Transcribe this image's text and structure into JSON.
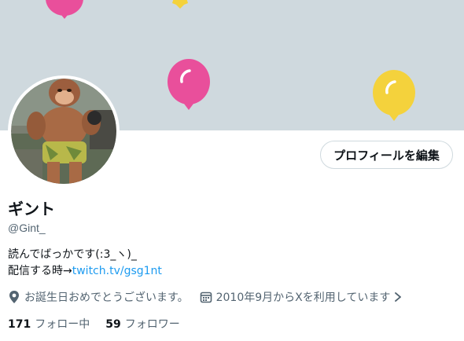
{
  "profile": {
    "display_name": "ギント",
    "handle": "@Gint_",
    "edit_button_label": "プロフィールを編集",
    "bio_line1": "読んでばっかです(:3_ヽ)_",
    "bio_line2_prefix": "配信する時→",
    "bio_link": "twitch.tv/gsg1nt",
    "birthday_text": "お誕生日おめでとうございます。",
    "joined_text": "2010年9月からXを利用しています"
  },
  "stats": {
    "following_count": "171",
    "following_label": "フォロー中",
    "followers_count": "59",
    "followers_label": "フォロワー"
  },
  "colors": {
    "banner_bg": "#cfd9de",
    "balloon_pink": "#e94f9b",
    "balloon_yellow": "#f4d23c",
    "link": "#1d9bf0"
  },
  "icons": [
    "location-pin-icon",
    "calendar-icon",
    "chevron-right-icon",
    "balloon-icon"
  ]
}
